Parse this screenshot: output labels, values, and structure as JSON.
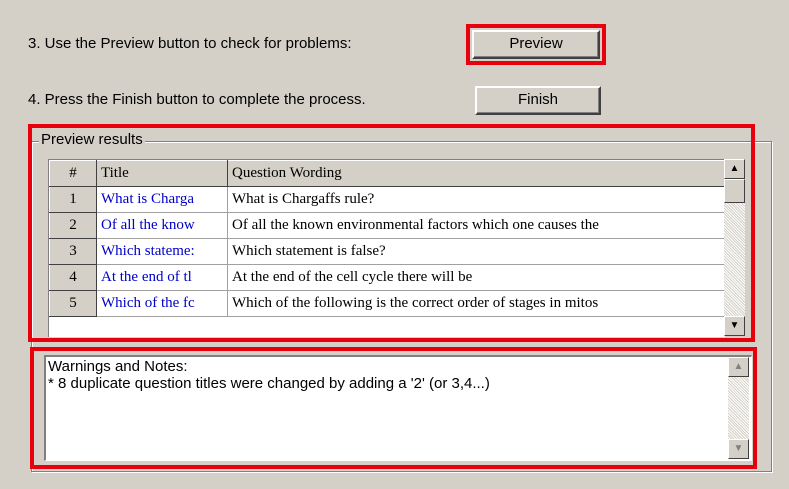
{
  "steps": {
    "step3": "3.  Use the Preview button to check for problems:",
    "step4": "4.  Press the Finish button to complete the process."
  },
  "buttons": {
    "preview": "Preview",
    "finish": "Finish"
  },
  "preview_results": {
    "legend": "Preview results",
    "columns": [
      "#",
      "Title",
      "Question Wording"
    ],
    "rows": [
      {
        "num": "1",
        "title": "What is Charga",
        "wording": "What is Chargaffs rule?"
      },
      {
        "num": "2",
        "title": "Of all the know",
        "wording": "Of all the known environmental factors which one causes the"
      },
      {
        "num": "3",
        "title": "Which stateme:",
        "wording": "Which statement is false?"
      },
      {
        "num": "4",
        "title": "At the end of tl",
        "wording": "At the end of the cell cycle there will be"
      },
      {
        "num": "5",
        "title": "Which of the fc",
        "wording": "Which of the following is the correct order of stages in mitos"
      }
    ]
  },
  "warnings": {
    "line1": "Warnings and Notes:",
    "line2": "* 8 duplicate question titles were changed by adding a '2' (or 3,4...)"
  },
  "colors": {
    "highlight": "#e8000d",
    "title_text": "#0000cc",
    "background": "#d4d0c8"
  },
  "icons": {
    "scroll_up": "triangle-up-icon",
    "scroll_down": "triangle-down-icon"
  }
}
